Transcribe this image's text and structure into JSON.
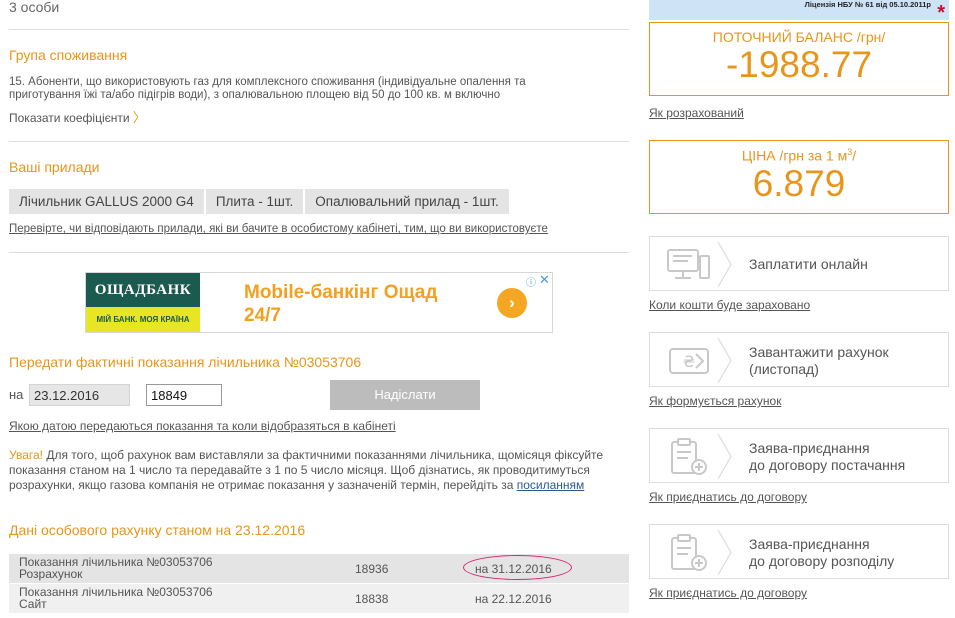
{
  "left": {
    "persons_text": "3 особи",
    "consumption_group": {
      "title": "Група споживання",
      "description_line1": "15. Абоненти, що використовують газ для комплексного споживання (індивідуальне опалення та",
      "description_line2": "приготування їжі та/або підігрів води), з опалювальною площею від 50 до 100 кв. м включно",
      "show_coefficients": "Показати коефіцієнти",
      "chevron": "〉"
    },
    "devices": {
      "title": "Ваші прилади",
      "items": [
        "Лічильник GALLUS 2000 G4",
        "Плита - 1шт.",
        "Опалювальний прилад - 1шт."
      ],
      "check_link": "Перевірте, чи відповідають прилади, які ви бачите в особистому кабінеті, тим, що ви використовуєте"
    },
    "banner": {
      "logo_top": "ОЩАДБАНК",
      "logo_bottom": "МІЙ БАНК. МОЯ КРАЇНА",
      "text_line1": "Mobile-банкінг Ощад",
      "text_line2": "24/7",
      "arrow": "›",
      "info_icon": "ⓘ",
      "close_icon": "✕"
    },
    "meter_form": {
      "title": "Передати фактичні показання лічильника №03053706",
      "on_label": "на",
      "date_value": "23.12.2016",
      "reading_value": "18849",
      "send_button": "Надіслати",
      "which_date_link": "Якою датою передаються показання та коли відобразяться в кабінеті"
    },
    "notice": {
      "attention": "Увага!",
      "line1": " Для того, щоб рахунок вам виставляли за фактичними показаннями лічильника, щомісяця фіксуйте",
      "line2": "показання станом на 1 число та передавайте з 1 по 5 число місяця. Щоб дізнатись, як проводитимуться",
      "line3": "розрахунки, якщо газова компанія не отримає показання у зазначеній термін, перейдіть за ",
      "link": "посиланням"
    },
    "account_data": {
      "title": "Дані особового рахунку станом на 23.12.2016",
      "rows": [
        {
          "label_line1": "Показання лічильника №03053706",
          "label_line2": "Розрахунок",
          "value": "18936",
          "date": "на 31.12.2016"
        },
        {
          "label_line1": "Показання лічильника №03053706",
          "label_line2": "Сайт",
          "value": "18838",
          "date": "на 22.12.2016"
        }
      ]
    }
  },
  "right": {
    "license_text": "Ліцензія НБУ № 61 від 05.10.2011р",
    "license_star": "*",
    "balance": {
      "label": "ПОТОЧНИЙ БАЛАНС /грн/",
      "value": "-1988.77",
      "link": "Як розрахований"
    },
    "price": {
      "label_prefix": "ЦІНА /грн за 1 м",
      "label_sup": "3",
      "label_suffix": "/",
      "value": "6.879"
    },
    "actions": [
      {
        "line1": "Заплатити онлайн",
        "line2": "",
        "link": "Коли кошти буде зараховано",
        "icon": "computer-icon"
      },
      {
        "line1": "Завантажити рахунок",
        "line2": "(листопад)",
        "link": "Як формується рахунок",
        "icon": "bill-icon"
      },
      {
        "line1": "Заява-приєднання",
        "line2": "до договору постачання",
        "link": "Як приєднатись до договору",
        "icon": "clipboard-add-icon"
      },
      {
        "line1": "Заява-приєднання",
        "line2": "до договору розподілу",
        "link": "Як приєднатись до договору",
        "icon": "clipboard-add-icon"
      }
    ]
  },
  "colors": {
    "accent": "#e8951b",
    "highlight_ellipse": "#d22a73",
    "bank_green": "#1b5b4f",
    "bank_yellow": "#e8e622"
  }
}
